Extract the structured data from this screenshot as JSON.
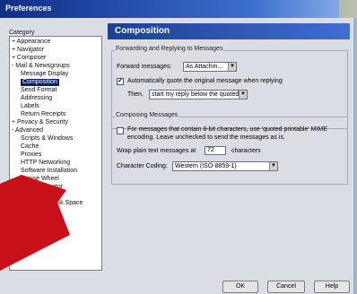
{
  "window": {
    "title": "Preferences"
  },
  "category_label": "Category",
  "tree": [
    {
      "label": "+ Appearance"
    },
    {
      "label": "+ Navigator"
    },
    {
      "label": "+ Composer"
    },
    {
      "label": "- Mail & Newsgroups"
    },
    {
      "label": "Message Display"
    },
    {
      "label": "Composition"
    },
    {
      "label": "Send Format"
    },
    {
      "label": "Addressing"
    },
    {
      "label": "Labels"
    },
    {
      "label": "Return Receipts"
    },
    {
      "label": "+ Privacy & Security"
    },
    {
      "label": "- Advanced"
    },
    {
      "label": "Scripts & Windows"
    },
    {
      "label": "Cache"
    },
    {
      "label": "Proxies"
    },
    {
      "label": "HTTP Networking"
    },
    {
      "label": "Software Installation"
    },
    {
      "label": "Mouse Wheel"
    },
    {
      "label": "DOM Inspector"
    },
    {
      "label": "stem"
    },
    {
      "label": "Disk Space"
    }
  ],
  "panel": {
    "title": "Composition",
    "forwarding": {
      "group_title": "Forwarding and Replying to Messages",
      "forward_label": "Forward messages:",
      "forward_value": "As Attachm...",
      "auto_quote_label": "Automatically quote the original message when replying",
      "auto_quote_checked": true,
      "then_label": "Then,",
      "then_value": "start my reply below the quoted t..."
    },
    "composing": {
      "group_title": "Composing Messages",
      "eightbit_line1": "For messages that contain 8-bit characters, use 'quoted printable' MIME",
      "eightbit_line2": "encoding. Leave unchecked to send the messages as is.",
      "wrap_label": "Wrap plain text messages at",
      "wrap_value": "72",
      "wrap_unit": "characters",
      "encoding_label": "Character Coding:",
      "encoding_value": "Western (ISO-8859-1)"
    }
  },
  "buttons": {
    "ok": "OK",
    "cancel": "Cancel",
    "help": "Help"
  },
  "colors": {
    "titlebar": "#1c3f92",
    "selection": "#0a246a",
    "arrow": "#c8101a",
    "background": "#dadde3"
  }
}
